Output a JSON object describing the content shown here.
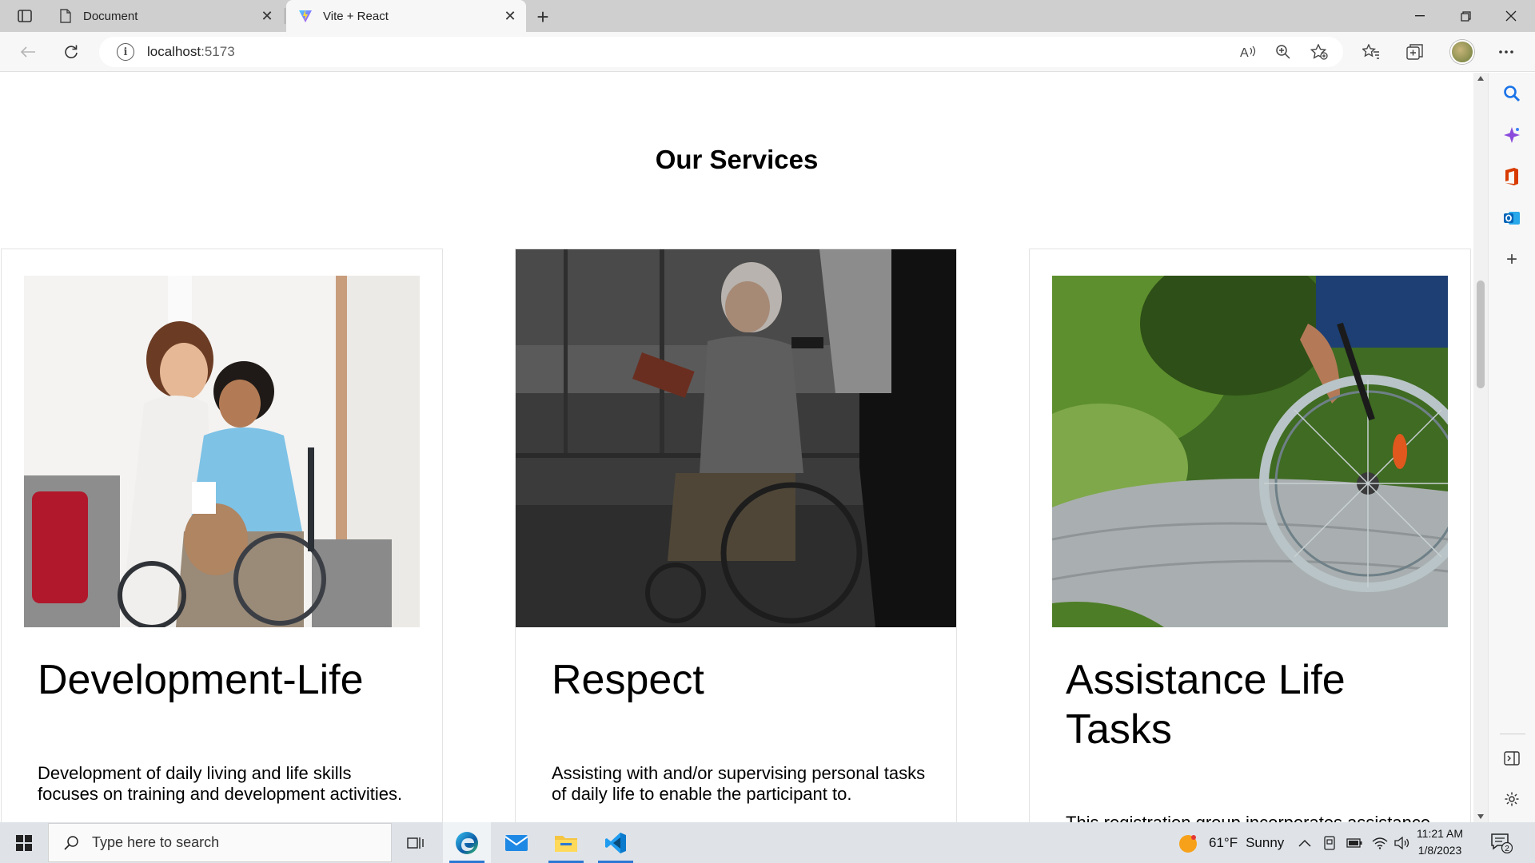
{
  "browser": {
    "tabs": [
      {
        "title": "Document",
        "favicon": "page-icon"
      },
      {
        "title": "Vite + React",
        "favicon": "vite-logo-icon"
      }
    ],
    "url_host": "localhost",
    "url_port": ":5173"
  },
  "page": {
    "section_title": "Our Services",
    "cards": [
      {
        "title": "Development-Life",
        "text": "Development of daily living and life skills focuses on training and development activities.",
        "image": "mother-helping-boy-in-wheelchair-photo"
      },
      {
        "title": "Respect",
        "text": "Assisting with and/or supervising personal tasks of daily life to enable the participant to.",
        "image": "caregiver-pushing-elderly-woman-wheelchair-photo"
      },
      {
        "title": "Assistance Life Tasks",
        "text": "This registration group incorporates assistance with or supervising tasks of daily life.",
        "image": "wheelchair-wheel-on-path-photo"
      }
    ]
  },
  "taskbar": {
    "search_placeholder": "Type here to search",
    "weather_temp": "61°F",
    "weather_text": "Sunny",
    "time": "11:21 AM",
    "date": "1/8/2023",
    "notification_count": "2"
  },
  "colors": {
    "accent": "#2b78d4",
    "vscode_blue": "#0a7acc",
    "office_red": "#d83b01"
  }
}
